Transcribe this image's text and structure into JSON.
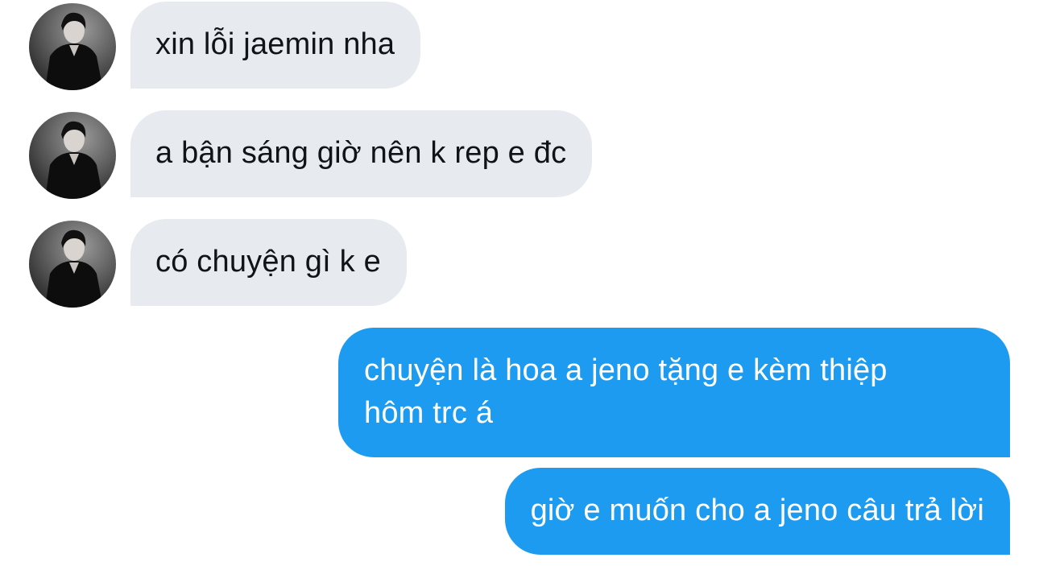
{
  "conversation": {
    "received": [
      {
        "text": "xin lỗi jaemin nha",
        "avatar_icon": "user-avatar-photo"
      },
      {
        "text": "a bận sáng giờ nên k rep e đc",
        "avatar_icon": "user-avatar-photo"
      },
      {
        "text": "có chuyện gì k e",
        "avatar_icon": "user-avatar-photo"
      }
    ],
    "sent": [
      {
        "line1": "chuyện là hoa a jeno tặng e kèm thiệp",
        "line2": "hôm trc á"
      },
      {
        "text": "giờ e muốn cho a jeno câu trả lời"
      }
    ]
  },
  "colors": {
    "received_bubble": "#e7eaee",
    "sent_bubble": "#1d9bf0",
    "received_text": "#0f1419",
    "sent_text": "#ffffff"
  }
}
